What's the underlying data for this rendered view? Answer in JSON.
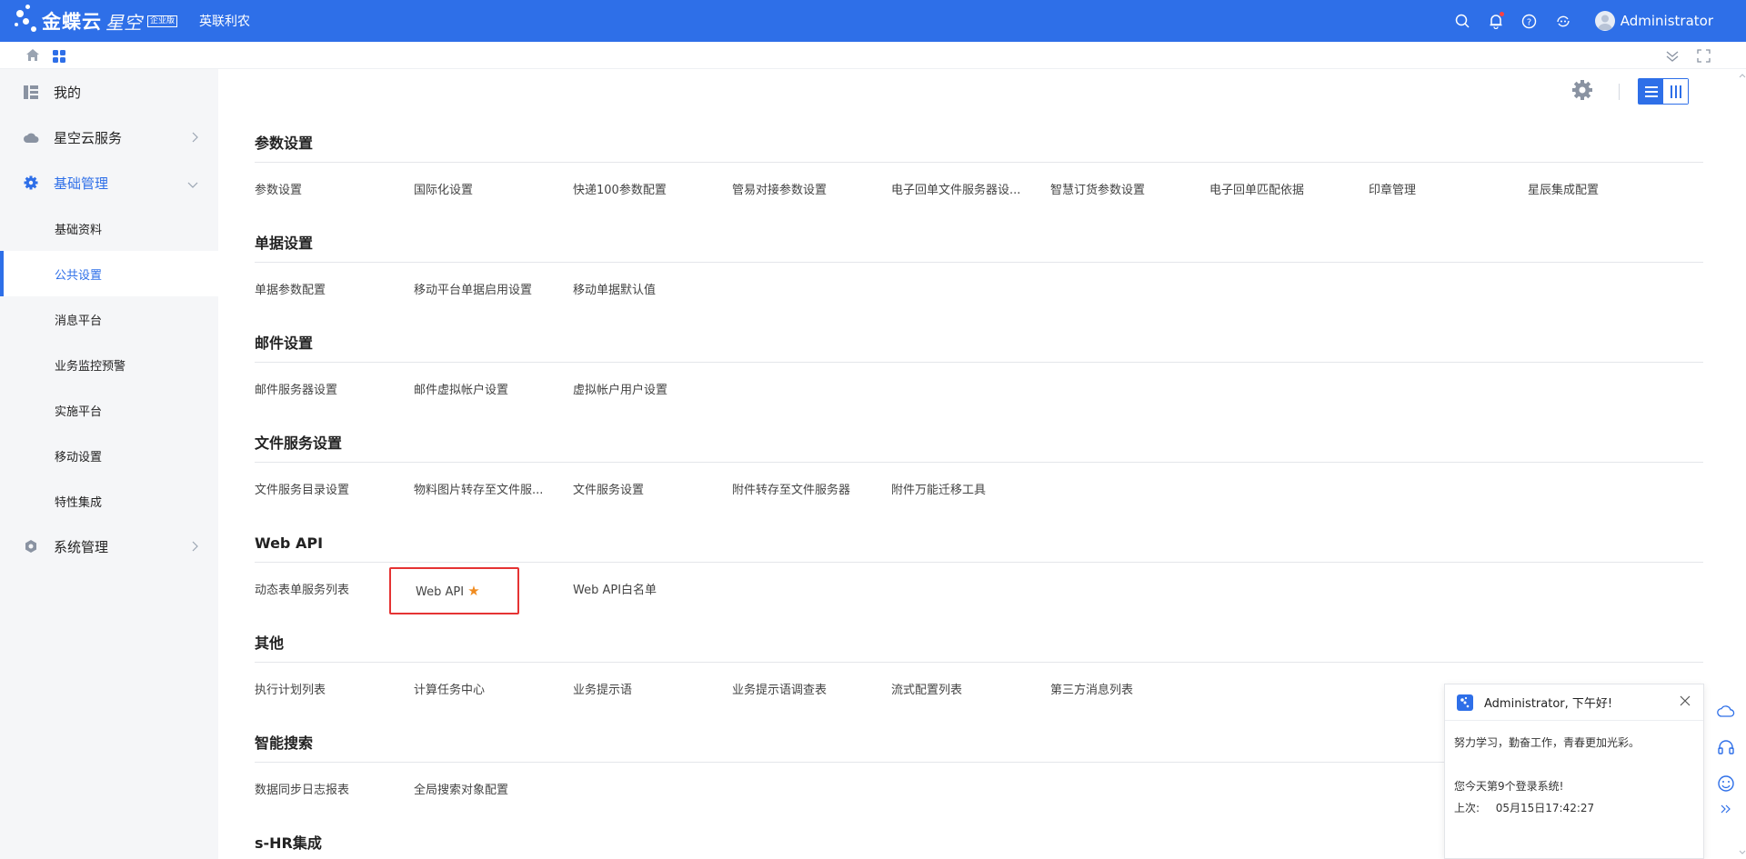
{
  "header": {
    "brand": "金蝶云",
    "brand_sub": "星空",
    "edition_badge": "企业版",
    "org_name": "英联利农",
    "user_name": "Administrator",
    "icons": [
      "search-icon",
      "bell-icon",
      "help-icon",
      "sync-icon",
      "avatar"
    ],
    "bg_color": "#2e6fe8"
  },
  "subbar": {
    "icons": [
      "home-icon",
      "apps-icon",
      "collapse-down-icon",
      "fullscreen-icon"
    ]
  },
  "sidebar": {
    "items": [
      {
        "label": "我的",
        "icon": "dashboard-icon"
      },
      {
        "label": "星空云服务",
        "icon": "cloud-icon"
      },
      {
        "label": "基础管理",
        "icon": "gear-icon"
      },
      {
        "label": "系统管理",
        "icon": "system-icon"
      }
    ],
    "sub_items": [
      {
        "label": "基础资料"
      },
      {
        "label": "公共设置"
      },
      {
        "label": "消息平台"
      },
      {
        "label": "业务监控预警"
      },
      {
        "label": "实施平台"
      },
      {
        "label": "移动设置"
      },
      {
        "label": "特性集成"
      }
    ],
    "selected": "公共设置",
    "accent_color": "#2e6fe8"
  },
  "sections": [
    {
      "title": "参数设置",
      "links": [
        "参数设置",
        "国际化设置",
        "快递100参数配置",
        "管易对接参数设置",
        "电子回单文件服务器设...",
        "智慧订货参数设置",
        "电子回单匹配依据",
        "印章管理",
        "星辰集成配置"
      ]
    },
    {
      "title": "单据设置",
      "links": [
        "单据参数配置",
        "移动平台单据启用设置",
        "移动单据默认值"
      ]
    },
    {
      "title": "邮件设置",
      "links": [
        "邮件服务器设置",
        "邮件虚拟帐户设置",
        "虚拟帐户用户设置"
      ]
    },
    {
      "title": "文件服务设置",
      "links": [
        "文件服务目录设置",
        "物料图片转存至文件服...",
        "文件服务设置",
        "附件转存至文件服务器",
        "附件万能迁移工具"
      ]
    },
    {
      "title": "Web API",
      "links": [
        "动态表单服务列表",
        "Web API",
        "Web API白名单"
      ]
    },
    {
      "title": "其他",
      "links": [
        "执行计划列表",
        "计算任务中心",
        "业务提示语",
        "业务提示语调查表",
        "流式配置列表",
        "第三方消息列表"
      ]
    },
    {
      "title": "智能搜索",
      "links": [
        "数据同步日志报表",
        "全局搜索对象配置"
      ]
    },
    {
      "title": "s-HR集成",
      "links": []
    }
  ],
  "highlight": {
    "link": "Web API",
    "favorite_icon": "star-icon",
    "star_color": "#f08b1f",
    "box_color": "#e53333"
  },
  "popup": {
    "greeting": "Administrator, 下午好!",
    "motto": "努力学习，勤奋工作，青春更加光彩。",
    "login_count": "您今天第9个登录系统!",
    "last_login_label": "上次:",
    "last_login_time": "05月15日17:42:27"
  },
  "right_rail": {
    "icons": [
      "cloud-outline-icon",
      "headset-icon",
      "smile-icon",
      "expand-right-icon"
    ]
  }
}
